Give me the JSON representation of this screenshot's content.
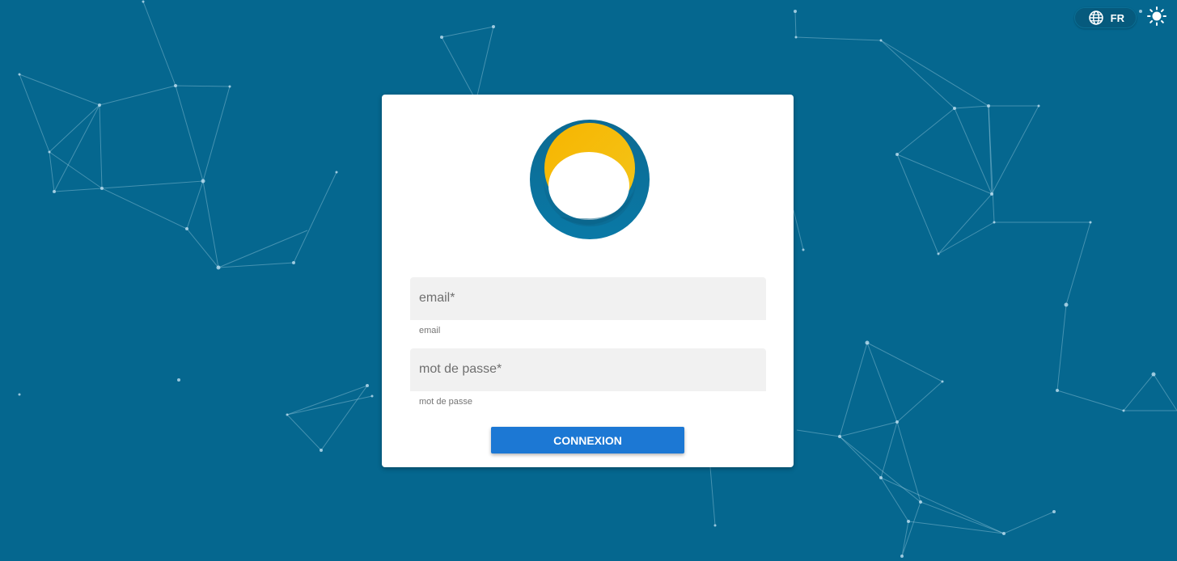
{
  "header": {
    "language_label": "FR",
    "language_icon": "globe-icon",
    "theme_icon": "sun-icon"
  },
  "login": {
    "logo_icon": "brand-logo",
    "email_placeholder": "email*",
    "email_hint": "email",
    "password_placeholder": "mot de passe*",
    "password_hint": "mot de passe",
    "submit_label": "CONNEXION"
  },
  "colors": {
    "background": "#05678f",
    "button": "#1c78d4",
    "logo_blue": "#0a6f94",
    "logo_yellow": "#f5b800",
    "card": "#ffffff"
  }
}
